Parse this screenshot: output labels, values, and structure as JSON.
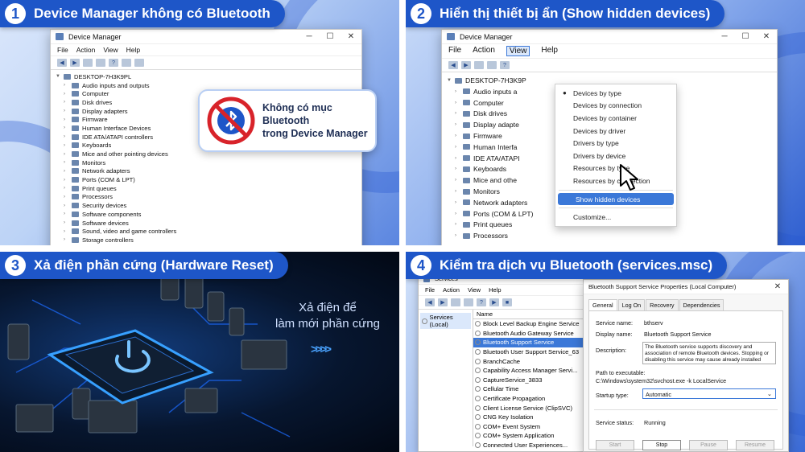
{
  "panels": [
    {
      "number": "1",
      "title": "Device Manager không có Bluetooth"
    },
    {
      "number": "2",
      "title": "Hiển thị thiết bị ẩn (Show hidden devices)"
    },
    {
      "number": "3",
      "title": "Xả điện phần cứng (Hardware Reset)"
    },
    {
      "number": "4",
      "title": "Kiểm tra dịch vụ Bluetooth (services.msc)"
    }
  ],
  "devmgr": {
    "title": "Device Manager",
    "menu": [
      "File",
      "Action",
      "View",
      "Help"
    ],
    "computer": "DESKTOP-7H3K9PL",
    "items": [
      "Audio inputs and outputs",
      "Computer",
      "Disk drives",
      "Display adapters",
      "Firmware",
      "Human Interface Devices",
      "IDE ATA/ATAPI controllers",
      "Keyboards",
      "Mice and other pointing devices",
      "Monitors",
      "Network adapters",
      "Ports (COM & LPT)",
      "Print queues",
      "Processors",
      "Security devices",
      "Software components",
      "Software devices",
      "Sound, video and game controllers",
      "Storage controllers",
      "System devices"
    ]
  },
  "callout": {
    "line1": "Không có mục",
    "line2": "Bluetooth",
    "line3": "trong Device Manager"
  },
  "devmgr2": {
    "title": "Device Manager",
    "menu": [
      "File",
      "Action",
      "View",
      "Help"
    ],
    "computer": "DESKTOP-7H3K9P",
    "items": [
      "Audio inputs a",
      "Computer",
      "Disk drives",
      "Display adapte",
      "Firmware",
      "Human Interfa",
      "IDE ATA/ATAPI",
      "Keyboards",
      "Mice and othe",
      "Monitors",
      "Network adapters",
      "Ports (COM & LPT)",
      "Print queues",
      "Processors"
    ]
  },
  "view_menu": {
    "items": [
      "Devices by type",
      "Devices by connection",
      "Devices by container",
      "Devices by driver",
      "Drivers by type",
      "Drivers by device",
      "Resources by type",
      "Resources by connection"
    ],
    "highlighted": "Show hidden devices",
    "customize": "Customize..."
  },
  "hardware": {
    "line1": "Xả điện để",
    "line2": "làm mới phần cứng",
    "arrows": ">>>>"
  },
  "services": {
    "title": "Services",
    "menu": [
      "File",
      "Action",
      "View",
      "Help"
    ],
    "left_node": "Services (Local)",
    "col_name": "Name",
    "rows": [
      "Block Level Backup Engine Service",
      "Bluetooth Audio Gateway Service",
      "Bluetooth Support Service",
      "Bluetooth User Support Service_63",
      "BranchCache",
      "Capability Access Manager Servi...",
      "CaptureService_3833",
      "Cellular Time",
      "Certificate Propagation",
      "Client License Service (ClipSVC)",
      "CNG Key Isolation",
      "COM+ Event System",
      "COM+ System Application",
      "Connected User Experiences..."
    ],
    "selected_index": 2
  },
  "props": {
    "title": "Bluetooth Support Service Properties (Local Computer)",
    "tabs": [
      "General",
      "Log On",
      "Recovery",
      "Dependencies"
    ],
    "service_name_label": "Service name:",
    "service_name": "bthserv",
    "display_name_label": "Display name:",
    "display_name": "Bluetooth Support Service",
    "description_label": "Description:",
    "description": "The Bluetooth service supports discovery and association of remote Bluetooth devices. Stopping or disabling this service may cause already installed",
    "path_label": "Path to executable:",
    "path": "C:\\Windows\\system32\\svchost.exe -k LocalService",
    "startup_label": "Startup type:",
    "startup": "Automatic",
    "status_label": "Service status:",
    "status": "Running",
    "buttons": [
      "Start",
      "Stop",
      "Pause",
      "Resume"
    ]
  },
  "colors": {
    "banner": "#1e56c8",
    "selection": "#3b78d8",
    "bluetooth_red": "#d8232a"
  }
}
